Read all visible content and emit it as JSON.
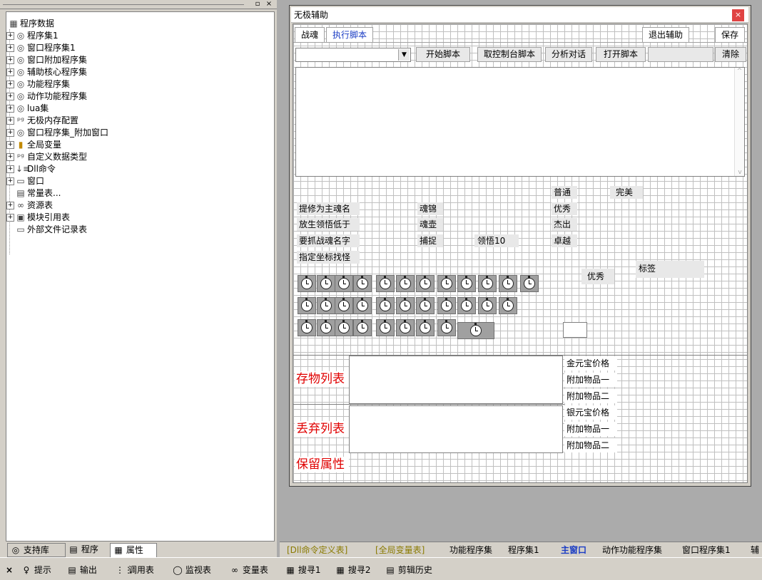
{
  "left_panel": {
    "tree": [
      {
        "label": "程序数据",
        "expander": "",
        "icon": "▦"
      },
      {
        "label": "程序集1",
        "expander": "+",
        "icon": "◎"
      },
      {
        "label": "窗口程序集1",
        "expander": "+",
        "icon": "◎"
      },
      {
        "label": "窗口附加程序集",
        "expander": "+",
        "icon": "◎"
      },
      {
        "label": "辅助核心程序集",
        "expander": "+",
        "icon": "◎"
      },
      {
        "label": "功能程序集",
        "expander": "+",
        "icon": "◎"
      },
      {
        "label": "动作功能程序集",
        "expander": "+",
        "icon": "◎"
      },
      {
        "label": "lua集",
        "expander": "+",
        "icon": "◎"
      },
      {
        "label": "无极内存配置",
        "expander": "+",
        "icon": "ᵖᵍ"
      },
      {
        "label": "窗口程序集_附加窗口",
        "expander": "+",
        "icon": "◎"
      },
      {
        "label": "全局变量",
        "expander": "+",
        "icon": "▮"
      },
      {
        "label": "自定义数据类型",
        "expander": "+",
        "icon": "ᵖᵍ"
      },
      {
        "label": "Dll命令",
        "expander": "+",
        "icon": "↓≡"
      },
      {
        "label": "窗口",
        "expander": "+",
        "icon": "▭"
      },
      {
        "label": "常量表...",
        "expander": "",
        "icon": "▤"
      },
      {
        "label": "资源表",
        "expander": "+",
        "icon": "∞"
      },
      {
        "label": "模块引用表",
        "expander": "+",
        "icon": "▣"
      },
      {
        "label": "外部文件记录表",
        "expander": "",
        "icon": "▭"
      }
    ],
    "tabs": [
      {
        "label": "支持库",
        "icon": "◎"
      },
      {
        "label": "程序",
        "icon": "▤"
      },
      {
        "label": "属性",
        "icon": "▦"
      }
    ]
  },
  "form": {
    "title": "无极辅助",
    "close_glyph": "×",
    "tabs": [
      "战魂",
      "执行脚本"
    ],
    "exit_button": "退出辅助",
    "save_button": "保存",
    "toolbar": {
      "start_script": "开始脚本",
      "console_script": "取控制台脚本",
      "analyze_dialog": "分析对话",
      "open_script": "打开脚本",
      "clear": "清除"
    },
    "labels": {
      "main_soul_name": "提修为主魂名",
      "release_below": "放生领悟低于",
      "catch_soul_name": "要抓战魂名字",
      "coord_catch": "指定坐标找怪",
      "soul_brocade": "魂锦",
      "soul_pot": "魂壶",
      "capture": "捕捉",
      "comprehend10": "领悟10",
      "normal": "普通",
      "perfect": "完美",
      "excellent": "优秀",
      "outstanding": "杰出",
      "supreme": "卓越",
      "excellent2": "优秀",
      "tag": "标签"
    },
    "storage_list": "存物列表",
    "discard_list": "丢弃列表",
    "keep_attr": "保留属性",
    "right_labels_1": [
      "金元宝价格",
      "附加物品一",
      "附加物品二"
    ],
    "right_labels_2": [
      "银元宝价格",
      "附加物品一",
      "附加物品二"
    ]
  },
  "bottom_tabs": [
    {
      "label": "[Dll命令定义表]",
      "style": "yellow"
    },
    {
      "label": "[全局变量表]",
      "style": "yellow"
    },
    {
      "label": "功能程序集",
      "style": "normal"
    },
    {
      "label": "程序集1",
      "style": "normal"
    },
    {
      "label": "主窗口",
      "style": "blue"
    },
    {
      "label": "动作功能程序集",
      "style": "normal"
    },
    {
      "label": "窗口程序集1",
      "style": "normal"
    },
    {
      "label": "辅",
      "style": "normal"
    }
  ],
  "status_bar": [
    {
      "label": "提示",
      "icon": "♀"
    },
    {
      "label": "输出",
      "icon": "▤"
    },
    {
      "label": "调用表",
      "icon": "⋮⋮"
    },
    {
      "label": "监视表",
      "icon": "◯"
    },
    {
      "label": "变量表",
      "icon": "∞"
    },
    {
      "label": "搜寻1",
      "icon": "▦"
    },
    {
      "label": "搜寻2",
      "icon": "▦"
    },
    {
      "label": "剪辑历史",
      "icon": "▤"
    }
  ]
}
